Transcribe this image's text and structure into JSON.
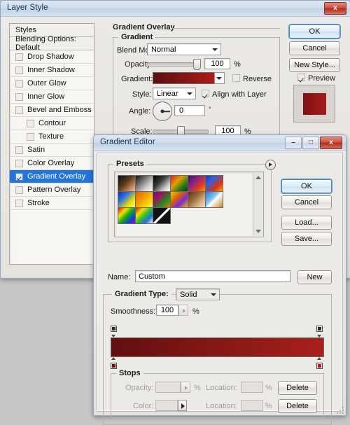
{
  "layer_style": {
    "title": "Layer Style",
    "close_label": "x",
    "styles_header": "Styles",
    "blending_options": "Blending Options: Default",
    "effects": [
      {
        "label": "Drop Shadow",
        "checked": false,
        "indent": false,
        "selected": false
      },
      {
        "label": "Inner Shadow",
        "checked": false,
        "indent": false,
        "selected": false
      },
      {
        "label": "Outer Glow",
        "checked": false,
        "indent": false,
        "selected": false
      },
      {
        "label": "Inner Glow",
        "checked": false,
        "indent": false,
        "selected": false
      },
      {
        "label": "Bevel and Emboss",
        "checked": false,
        "indent": false,
        "selected": false
      },
      {
        "label": "Contour",
        "checked": false,
        "indent": true,
        "selected": false
      },
      {
        "label": "Texture",
        "checked": false,
        "indent": true,
        "selected": false
      },
      {
        "label": "Satin",
        "checked": false,
        "indent": false,
        "selected": false
      },
      {
        "label": "Color Overlay",
        "checked": false,
        "indent": false,
        "selected": false
      },
      {
        "label": "Gradient Overlay",
        "checked": true,
        "indent": false,
        "selected": true
      },
      {
        "label": "Pattern Overlay",
        "checked": false,
        "indent": false,
        "selected": false
      },
      {
        "label": "Stroke",
        "checked": false,
        "indent": false,
        "selected": false
      }
    ],
    "panel_title": "Gradient Overlay",
    "group_title": "Gradient",
    "blend_mode": {
      "label": "Blend Mode:",
      "value": "Normal"
    },
    "opacity": {
      "label": "Opacity:",
      "value": "100",
      "unit": "%",
      "percent": 100
    },
    "gradient": {
      "label": "Gradient:",
      "from": "#5c0f0f",
      "to": "#b01a1a"
    },
    "reverse": {
      "label": "Reverse",
      "checked": false
    },
    "style": {
      "label": "Style:",
      "value": "Linear"
    },
    "align": {
      "label": "Align with Layer",
      "checked": true
    },
    "angle": {
      "label": "Angle:",
      "value": "0",
      "unit": "°"
    },
    "scale": {
      "label": "Scale:",
      "value": "100",
      "unit": "%",
      "percent": 50
    },
    "buttons": {
      "ok": "OK",
      "cancel": "Cancel",
      "new_style": "New Style..."
    },
    "preview": {
      "label": "Preview",
      "checked": true,
      "swatch_from": "#7e1111",
      "swatch_to": "#a51d1d"
    }
  },
  "gradient_editor": {
    "title": "Gradient Editor",
    "minimize_label": "–",
    "maximize_label": "□",
    "close_label": "x",
    "presets": {
      "label": "Presets",
      "swatches": [
        "linear-gradient(135deg,#120d08 0%,#5a3a1e 45%,#b8784a 72%,#f0c6a4 100%)",
        "linear-gradient(135deg,#111111 0%,#8a8a8a 45%,#cfcfcf 70%,#ffffff 100%)",
        "linear-gradient(135deg,#000000 0%,#3a3a3a 40%,#c9c9c9 75%,#ffffff 100%)",
        "linear-gradient(135deg,#e01b1b 0%,#e0a000 38%,#1d7a1d 72%,#0b3d0b 100%)",
        "linear-gradient(135deg,#3a1060 0%,#8a1f8a 35%,#e03a1a 70%,#f0a000 100%)",
        "linear-gradient(135deg,#1030c0 0%,#3060e0 30%,#e03010 70%,#f0b000 100%)",
        "linear-gradient(135deg,#1030c0 0%,#2a6fe0 32%,#f0e000 72%,#f7f0a0 100%)",
        "linear-gradient(135deg,#e06000 0%,#f09000 35%,#f5d000 70%,#fbe98a 100%)",
        "linear-gradient(135deg,#5a1080 0%,#a01060 30%,#1f8a1f 65%,#e08000 100%)",
        "linear-gradient(135deg,#f0d000 0%,#e06a00 32%,#7a2ad0 66%,#f0c000 100%)",
        "linear-gradient(135deg,#5a3218 0%,#9a6a3a 40%,#d8b48a 72%,#f2e0cc 100%)",
        "linear-gradient(135deg,#1e7ad8 0%,#8ec8f0 42%,#ffffff 52%,#c08a30 100%)",
        "linear-gradient(135deg,#e01010 0%,#f0e000 28%,#10b010 50%,#1040e0 76%,#8a10c0 100%)",
        "linear-gradient(135deg,#e01010 0%,#f0e000 26%,#30c030 50%,#2070e0 74%,#ffffff 100%)",
        "linear-gradient(135deg,#111 0%,#111 45%,#ffffff 46%,#ffffff 55%,#111 56%,#111 100%)"
      ]
    },
    "buttons": {
      "ok": "OK",
      "cancel": "Cancel",
      "load": "Load...",
      "save": "Save...",
      "new": "New"
    },
    "name": {
      "label": "Name:",
      "value": "Custom"
    },
    "gradient_type": {
      "label": "Gradient Type:",
      "value": "Solid"
    },
    "smoothness": {
      "label": "Smoothness:",
      "value": "100",
      "unit": "%"
    },
    "gradient_bar": {
      "from": "#61100f",
      "to": "#a8201a"
    },
    "stops": {
      "label": "Stops",
      "opacity": {
        "label": "Opacity:",
        "value": "",
        "unit": "%"
      },
      "opacity_location": {
        "label": "Location:",
        "value": "",
        "unit": "%"
      },
      "color": {
        "label": "Color:",
        "value": "",
        "unit": "%"
      },
      "color_location": {
        "label": "Location:",
        "value": "",
        "unit": "%"
      },
      "delete_top": "Delete",
      "delete_bottom": "Delete",
      "color_stop_left": "#6a120f",
      "color_stop_right": "#b02420"
    }
  }
}
